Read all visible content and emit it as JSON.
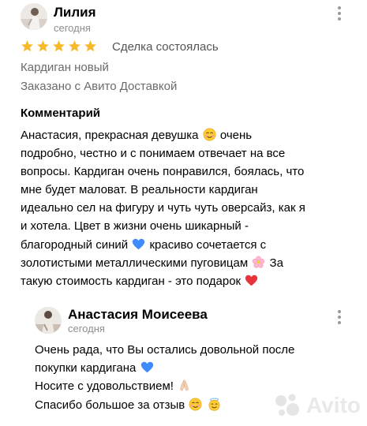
{
  "review": {
    "author": "Лилия",
    "date": "сегодня",
    "rating": 5,
    "deal_status": "Сделка состоялась",
    "item_title": "Кардиган новый",
    "delivery": "Заказано с Авито Доставкой",
    "comment_heading": "Комментарий",
    "comment_lines": [
      "Анастасия, прекрасная девушка",
      "очень",
      "подробно, честно и с понимаем отвечает на все",
      "вопросы. Кардиган очень понравился, боялась, что",
      "мне будет маловат. В реальности кардиган",
      "идеально сел на фигуру и чуть чуть оверсайз, как я",
      "и хотела. Цвет в жизни очень шикарный -",
      "благородный синий",
      "красиво сочетается с",
      "золотистыми металлическими пуговицам",
      "За",
      "такую стоимость кардиган - это подарок"
    ]
  },
  "reply": {
    "author": "Анастасия Моисеева",
    "date": "сегодня",
    "lines": [
      "Очень рада, что Вы остались довольной после",
      "покупки кардигана",
      "Носите с удовольствием!",
      "Спасибо большое за отзыв"
    ]
  },
  "watermark": {
    "brand": "Avito"
  },
  "icons": {
    "star": "star-icon",
    "more": "kebab-menu-icon",
    "blush": "smiling-face-icon",
    "blue_heart": "blue-heart-icon",
    "flower": "cherry-blossom-icon",
    "red_heart": "red-heart-icon",
    "praying_hands": "folded-hands-icon",
    "angel": "halo-face-icon"
  },
  "colors": {
    "star": "#F7B928",
    "muted_text": "#8F8F8F",
    "watermark_dot_1": "#97CF26",
    "watermark_dot_2": "#A169F7",
    "watermark_dot_3": "#FF6163",
    "watermark_dot_4": "#00AAFF"
  }
}
